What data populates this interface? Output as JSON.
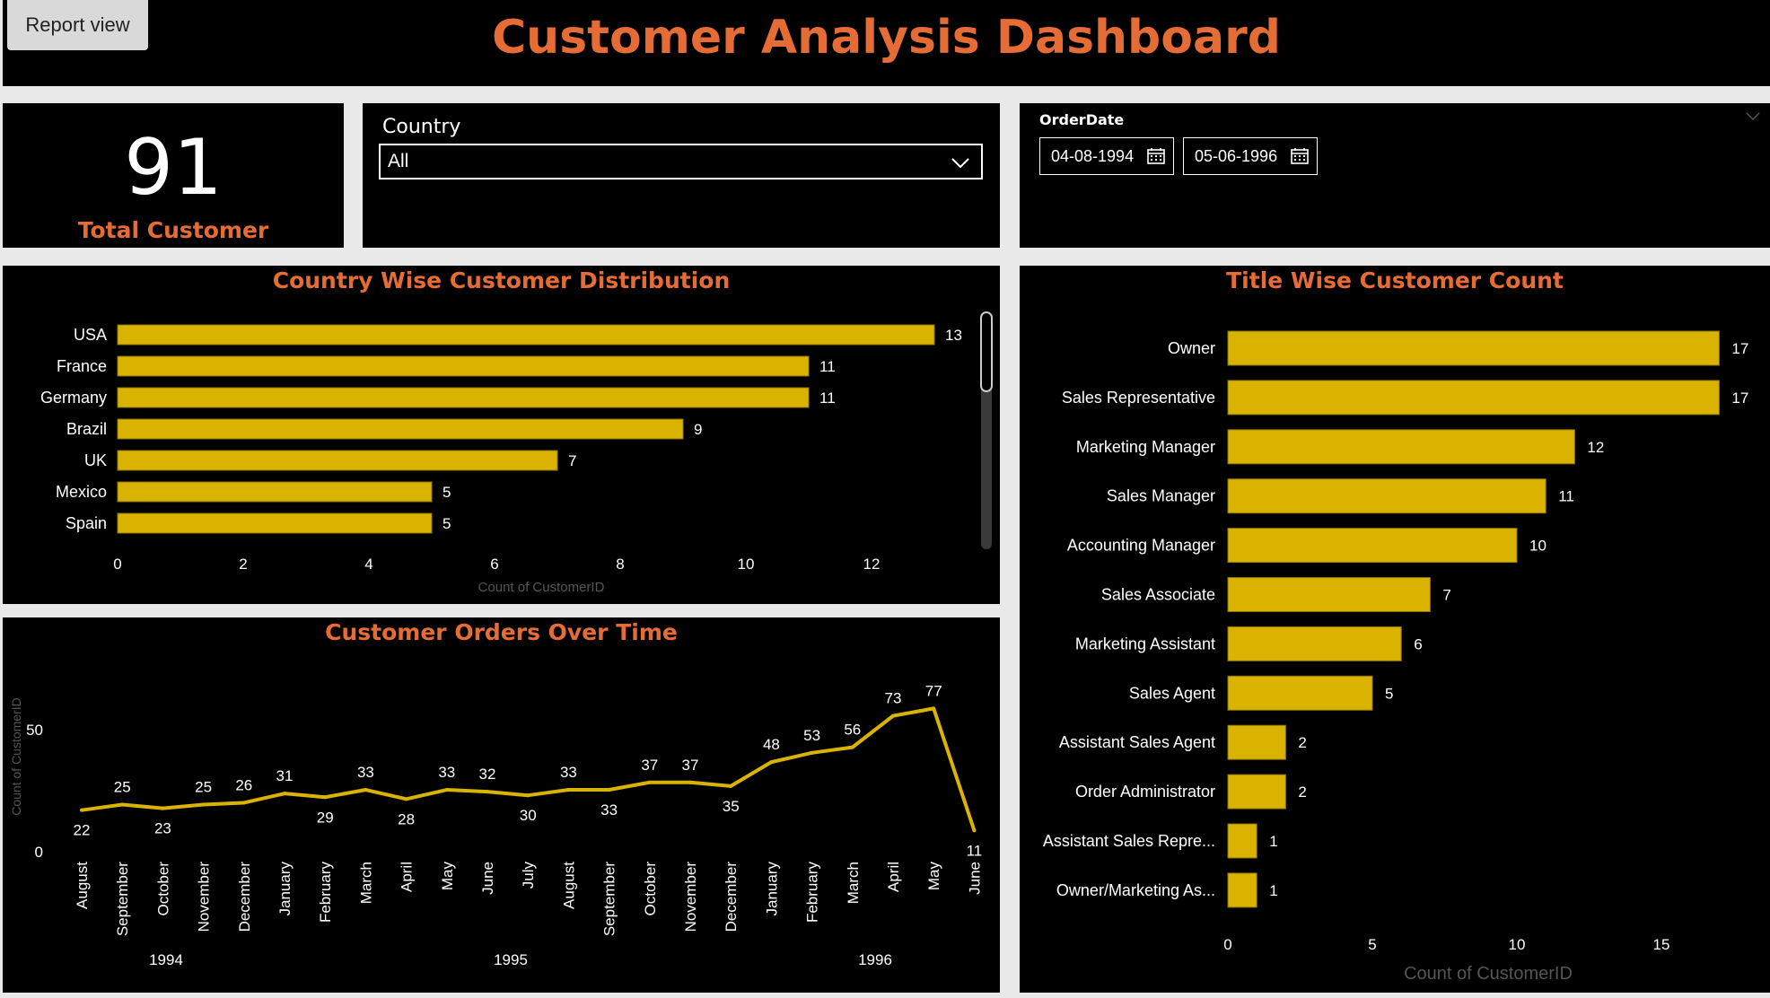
{
  "header": {
    "title": "Customer Analysis Dashboard",
    "report_view_label": "Report view"
  },
  "kpi": {
    "value": "91",
    "label": "Total Customer"
  },
  "country_slicer": {
    "title": "Country",
    "selected": "All"
  },
  "date_slicer": {
    "title": "OrderDate",
    "start": "04-08-1994",
    "end": "05-06-1996"
  },
  "colors": {
    "accent": "#e56c35",
    "bar": "#d9b300",
    "panel": "#000000",
    "text": "#ffffff",
    "axis_title": "#555555"
  },
  "chart_data": [
    {
      "type": "bar",
      "orientation": "horizontal",
      "title": "Country Wise Customer Distribution",
      "categories": [
        "USA",
        "France",
        "Germany",
        "Brazil",
        "UK",
        "Mexico",
        "Spain"
      ],
      "values": [
        13,
        11,
        11,
        9,
        7,
        5,
        5
      ],
      "xlabel": "Count of CustomerID",
      "xlim": [
        0,
        13
      ],
      "xticks": [
        0,
        2,
        4,
        6,
        8,
        10,
        12
      ],
      "data_labels": true
    },
    {
      "type": "line",
      "title": "Customer Orders Over Time",
      "ylabel": "Count of CustomerID",
      "yticks": [
        0,
        50
      ],
      "x": [
        "August",
        "September",
        "October",
        "November",
        "December",
        "January",
        "February",
        "March",
        "April",
        "May",
        "June",
        "July",
        "August",
        "September",
        "October",
        "November",
        "December",
        "January",
        "February",
        "March",
        "April",
        "May",
        "June"
      ],
      "year_labels": [
        "1994",
        "1995",
        "1996"
      ],
      "values": [
        22,
        25,
        23,
        25,
        26,
        31,
        29,
        33,
        28,
        33,
        32,
        30,
        33,
        33,
        37,
        37,
        35,
        48,
        53,
        56,
        73,
        77,
        11
      ],
      "data_labels": true
    },
    {
      "type": "bar",
      "orientation": "horizontal",
      "title": "Title Wise Customer Count",
      "categories": [
        "Owner",
        "Sales Representative",
        "Marketing Manager",
        "Sales Manager",
        "Accounting Manager",
        "Sales Associate",
        "Marketing Assistant",
        "Sales Agent",
        "Assistant Sales Agent",
        "Order Administrator",
        "Assistant Sales Repre...",
        "Owner/Marketing As..."
      ],
      "values": [
        17,
        17,
        12,
        11,
        10,
        7,
        6,
        5,
        2,
        2,
        1,
        1
      ],
      "xlabel": "Count of CustomerID",
      "xticks": [
        0,
        5,
        10,
        15
      ],
      "data_labels": true
    }
  ]
}
